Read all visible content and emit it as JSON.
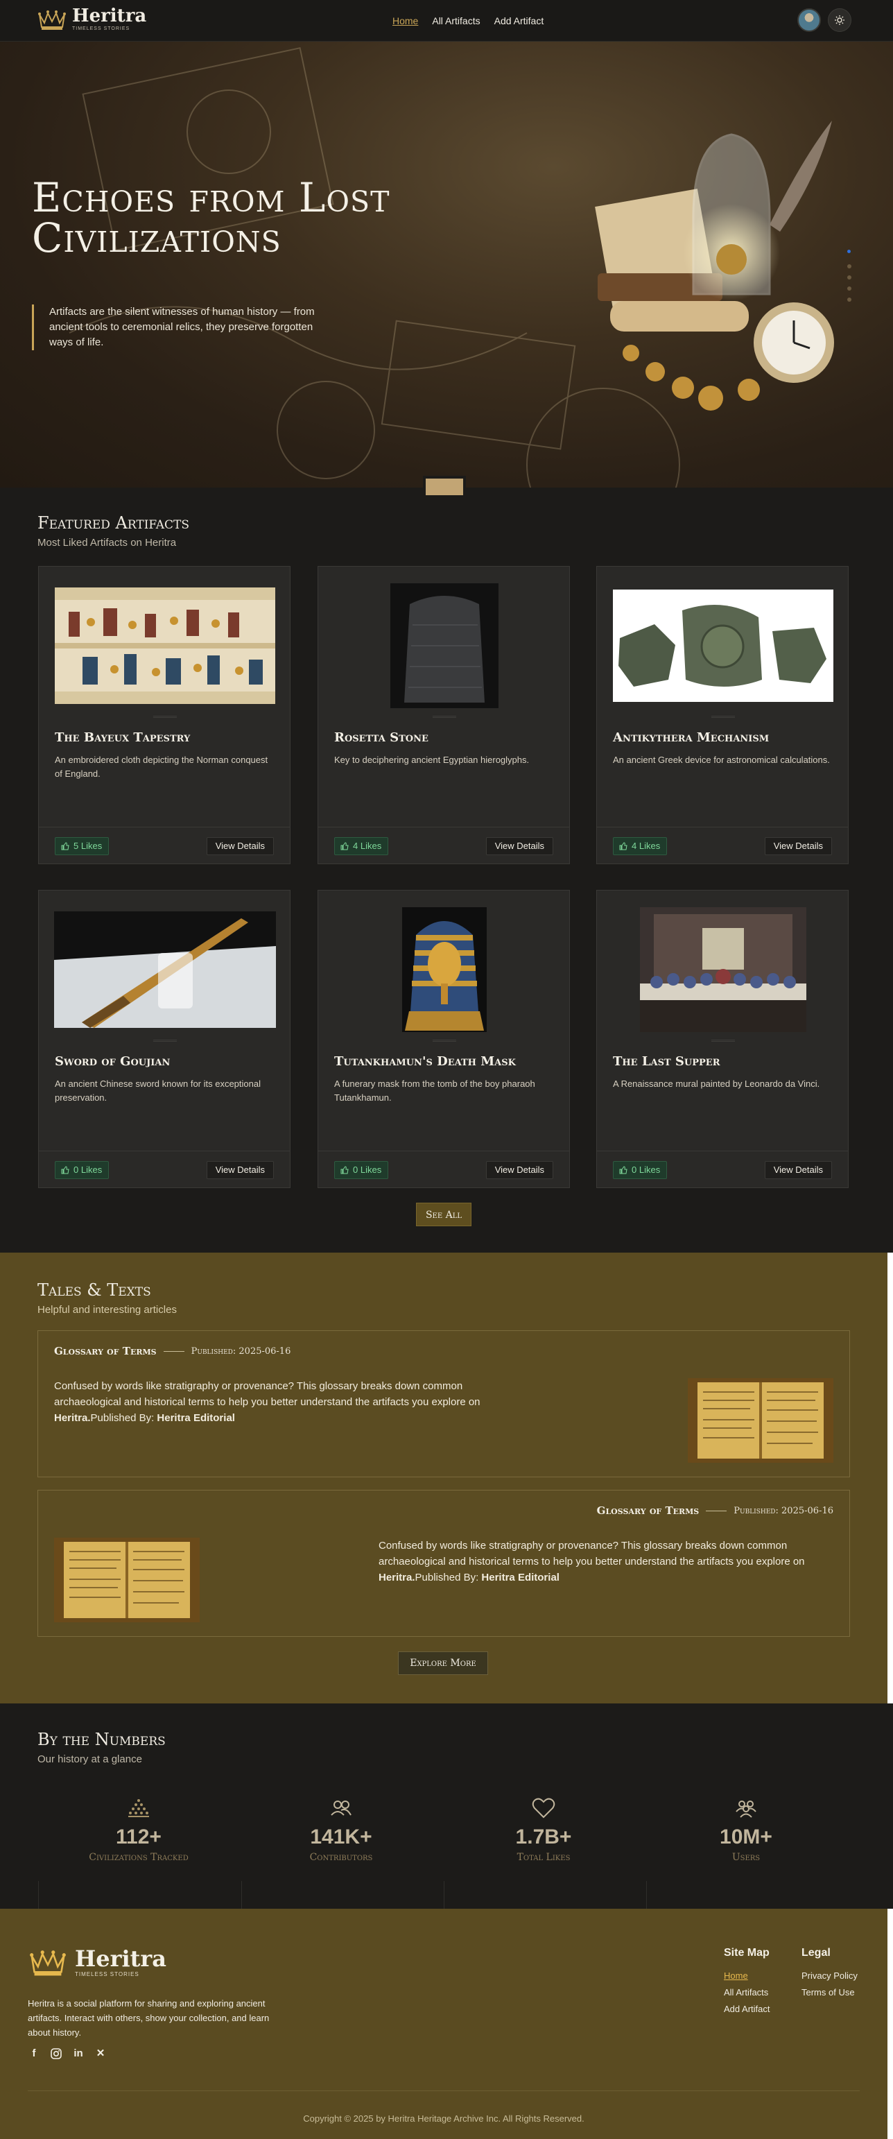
{
  "nav": {
    "brand": "Heritra",
    "tagline": "TIMELESS STORIES",
    "links": [
      {
        "label": "Home",
        "active": true
      },
      {
        "label": "All Artifacts",
        "active": false
      },
      {
        "label": "Add Artifact",
        "active": false
      }
    ],
    "avatar_icon": "user-avatar",
    "theme_icon": "sun-icon"
  },
  "hero": {
    "title": "Echoes from Lost Civilizations",
    "description": "Artifacts are the silent witnesses of human history — from ancient tools to ceremonial relics, they preserve forgotten ways of life."
  },
  "featured": {
    "title": "Featured Artifacts",
    "subtitle": "Most Liked Artifacts on Heritra",
    "view_label": "View Details",
    "cards": [
      {
        "title": "The Bayeux Tapestry",
        "desc": "An embroidered cloth depicting the Norman conquest of England.",
        "likes": "5 Likes"
      },
      {
        "title": "Rosetta Stone",
        "desc": "Key to deciphering ancient Egyptian hieroglyphs.",
        "likes": "4 Likes"
      },
      {
        "title": "Antikythera Mechanism",
        "desc": "An ancient Greek device for astronomical calculations.",
        "likes": "4 Likes"
      },
      {
        "title": "Sword of Goujian",
        "desc": "An ancient Chinese sword known for its exceptional preservation.",
        "likes": "0 Likes"
      },
      {
        "title": "Tutankhamun's Death Mask",
        "desc": "A funerary mask from the tomb of the boy pharaoh Tutankhamun.",
        "likes": "0 Likes"
      },
      {
        "title": "The Last Supper",
        "desc": "A Renaissance mural painted by Leonardo da Vinci.",
        "likes": "0 Likes"
      }
    ],
    "see_all": "See All"
  },
  "tales": {
    "title": "Tales & Texts",
    "subtitle": "Helpful and interesting articles",
    "articles": [
      {
        "title": "Glossary of Terms",
        "published": "Published: 2025-06-16",
        "body": "Confused by words like stratigraphy or provenance? This glossary breaks down common archaeological and historical terms to help you better understand the artifacts you explore on ",
        "brand": "Heritra.",
        "by_label": "Published By: ",
        "author": "Heritra Editorial"
      },
      {
        "title": "Glossary of Terms",
        "published": "Published: 2025-06-16",
        "body": "Confused by words like stratigraphy or provenance? This glossary breaks down common archaeological and historical terms to help you better understand the artifacts you explore on ",
        "brand": "Heritra.",
        "by_label": "Published By: ",
        "author": "Heritra Editorial"
      }
    ],
    "explore": "Explore More"
  },
  "numbers": {
    "title": "By the Numbers",
    "subtitle": "Our history at a glance",
    "stats": [
      {
        "value": "112+",
        "label": "Civilizations Tracked",
        "icon": "pyramid-icon"
      },
      {
        "value": "141K+",
        "label": "Contributors",
        "icon": "users-icon"
      },
      {
        "value": "1.7B+",
        "label": "Total Likes",
        "icon": "heart-icon"
      },
      {
        "value": "10M+",
        "label": "Users",
        "icon": "group-icon"
      }
    ]
  },
  "footer": {
    "brand": "Heritra",
    "tagline": "TIMELESS STORIES",
    "description": "Heritra is a social platform for sharing and exploring ancient artifacts. Interact with others, show your collection, and learn about history.",
    "socials": [
      "facebook-icon",
      "instagram-icon",
      "linkedin-icon",
      "x-icon"
    ],
    "sitemap": {
      "title": "Site Map",
      "links": [
        "Home",
        "All Artifacts",
        "Add Artifact"
      ]
    },
    "legal": {
      "title": "Legal",
      "links": [
        "Privacy Policy",
        "Terms of Use"
      ]
    },
    "copyright": "Copyright © 2025 by Heritra Heritage Archive Inc. All Rights Reserved."
  },
  "colors": {
    "accent": "#c9a557",
    "likes_green": "#7fd89a",
    "olive": "#5a4b21"
  }
}
